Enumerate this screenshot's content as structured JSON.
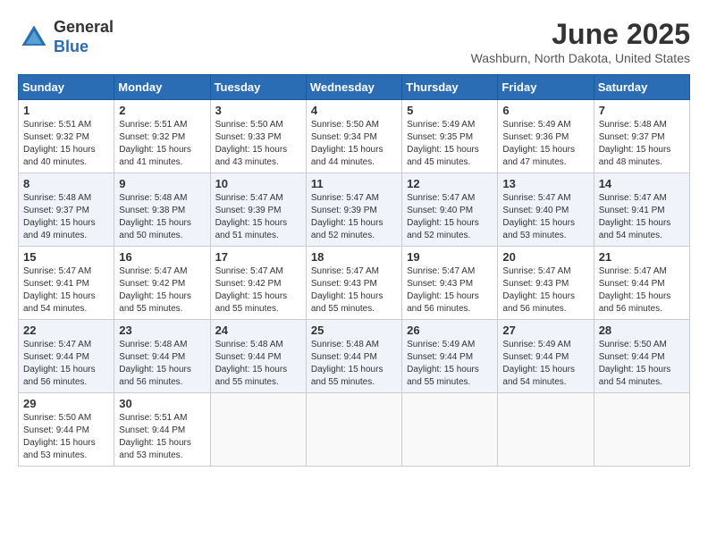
{
  "header": {
    "logo_general": "General",
    "logo_blue": "Blue",
    "month_title": "June 2025",
    "location": "Washburn, North Dakota, United States"
  },
  "days_of_week": [
    "Sunday",
    "Monday",
    "Tuesday",
    "Wednesday",
    "Thursday",
    "Friday",
    "Saturday"
  ],
  "weeks": [
    [
      {
        "day": "1",
        "info": "Sunrise: 5:51 AM\nSunset: 9:32 PM\nDaylight: 15 hours\nand 40 minutes."
      },
      {
        "day": "2",
        "info": "Sunrise: 5:51 AM\nSunset: 9:32 PM\nDaylight: 15 hours\nand 41 minutes."
      },
      {
        "day": "3",
        "info": "Sunrise: 5:50 AM\nSunset: 9:33 PM\nDaylight: 15 hours\nand 43 minutes."
      },
      {
        "day": "4",
        "info": "Sunrise: 5:50 AM\nSunset: 9:34 PM\nDaylight: 15 hours\nand 44 minutes."
      },
      {
        "day": "5",
        "info": "Sunrise: 5:49 AM\nSunset: 9:35 PM\nDaylight: 15 hours\nand 45 minutes."
      },
      {
        "day": "6",
        "info": "Sunrise: 5:49 AM\nSunset: 9:36 PM\nDaylight: 15 hours\nand 47 minutes."
      },
      {
        "day": "7",
        "info": "Sunrise: 5:48 AM\nSunset: 9:37 PM\nDaylight: 15 hours\nand 48 minutes."
      }
    ],
    [
      {
        "day": "8",
        "info": "Sunrise: 5:48 AM\nSunset: 9:37 PM\nDaylight: 15 hours\nand 49 minutes."
      },
      {
        "day": "9",
        "info": "Sunrise: 5:48 AM\nSunset: 9:38 PM\nDaylight: 15 hours\nand 50 minutes."
      },
      {
        "day": "10",
        "info": "Sunrise: 5:47 AM\nSunset: 9:39 PM\nDaylight: 15 hours\nand 51 minutes."
      },
      {
        "day": "11",
        "info": "Sunrise: 5:47 AM\nSunset: 9:39 PM\nDaylight: 15 hours\nand 52 minutes."
      },
      {
        "day": "12",
        "info": "Sunrise: 5:47 AM\nSunset: 9:40 PM\nDaylight: 15 hours\nand 52 minutes."
      },
      {
        "day": "13",
        "info": "Sunrise: 5:47 AM\nSunset: 9:40 PM\nDaylight: 15 hours\nand 53 minutes."
      },
      {
        "day": "14",
        "info": "Sunrise: 5:47 AM\nSunset: 9:41 PM\nDaylight: 15 hours\nand 54 minutes."
      }
    ],
    [
      {
        "day": "15",
        "info": "Sunrise: 5:47 AM\nSunset: 9:41 PM\nDaylight: 15 hours\nand 54 minutes."
      },
      {
        "day": "16",
        "info": "Sunrise: 5:47 AM\nSunset: 9:42 PM\nDaylight: 15 hours\nand 55 minutes."
      },
      {
        "day": "17",
        "info": "Sunrise: 5:47 AM\nSunset: 9:42 PM\nDaylight: 15 hours\nand 55 minutes."
      },
      {
        "day": "18",
        "info": "Sunrise: 5:47 AM\nSunset: 9:43 PM\nDaylight: 15 hours\nand 55 minutes."
      },
      {
        "day": "19",
        "info": "Sunrise: 5:47 AM\nSunset: 9:43 PM\nDaylight: 15 hours\nand 56 minutes."
      },
      {
        "day": "20",
        "info": "Sunrise: 5:47 AM\nSunset: 9:43 PM\nDaylight: 15 hours\nand 56 minutes."
      },
      {
        "day": "21",
        "info": "Sunrise: 5:47 AM\nSunset: 9:44 PM\nDaylight: 15 hours\nand 56 minutes."
      }
    ],
    [
      {
        "day": "22",
        "info": "Sunrise: 5:47 AM\nSunset: 9:44 PM\nDaylight: 15 hours\nand 56 minutes."
      },
      {
        "day": "23",
        "info": "Sunrise: 5:48 AM\nSunset: 9:44 PM\nDaylight: 15 hours\nand 56 minutes."
      },
      {
        "day": "24",
        "info": "Sunrise: 5:48 AM\nSunset: 9:44 PM\nDaylight: 15 hours\nand 55 minutes."
      },
      {
        "day": "25",
        "info": "Sunrise: 5:48 AM\nSunset: 9:44 PM\nDaylight: 15 hours\nand 55 minutes."
      },
      {
        "day": "26",
        "info": "Sunrise: 5:49 AM\nSunset: 9:44 PM\nDaylight: 15 hours\nand 55 minutes."
      },
      {
        "day": "27",
        "info": "Sunrise: 5:49 AM\nSunset: 9:44 PM\nDaylight: 15 hours\nand 54 minutes."
      },
      {
        "day": "28",
        "info": "Sunrise: 5:50 AM\nSunset: 9:44 PM\nDaylight: 15 hours\nand 54 minutes."
      }
    ],
    [
      {
        "day": "29",
        "info": "Sunrise: 5:50 AM\nSunset: 9:44 PM\nDaylight: 15 hours\nand 53 minutes."
      },
      {
        "day": "30",
        "info": "Sunrise: 5:51 AM\nSunset: 9:44 PM\nDaylight: 15 hours\nand 53 minutes."
      },
      {
        "day": "",
        "info": ""
      },
      {
        "day": "",
        "info": ""
      },
      {
        "day": "",
        "info": ""
      },
      {
        "day": "",
        "info": ""
      },
      {
        "day": "",
        "info": ""
      }
    ]
  ]
}
